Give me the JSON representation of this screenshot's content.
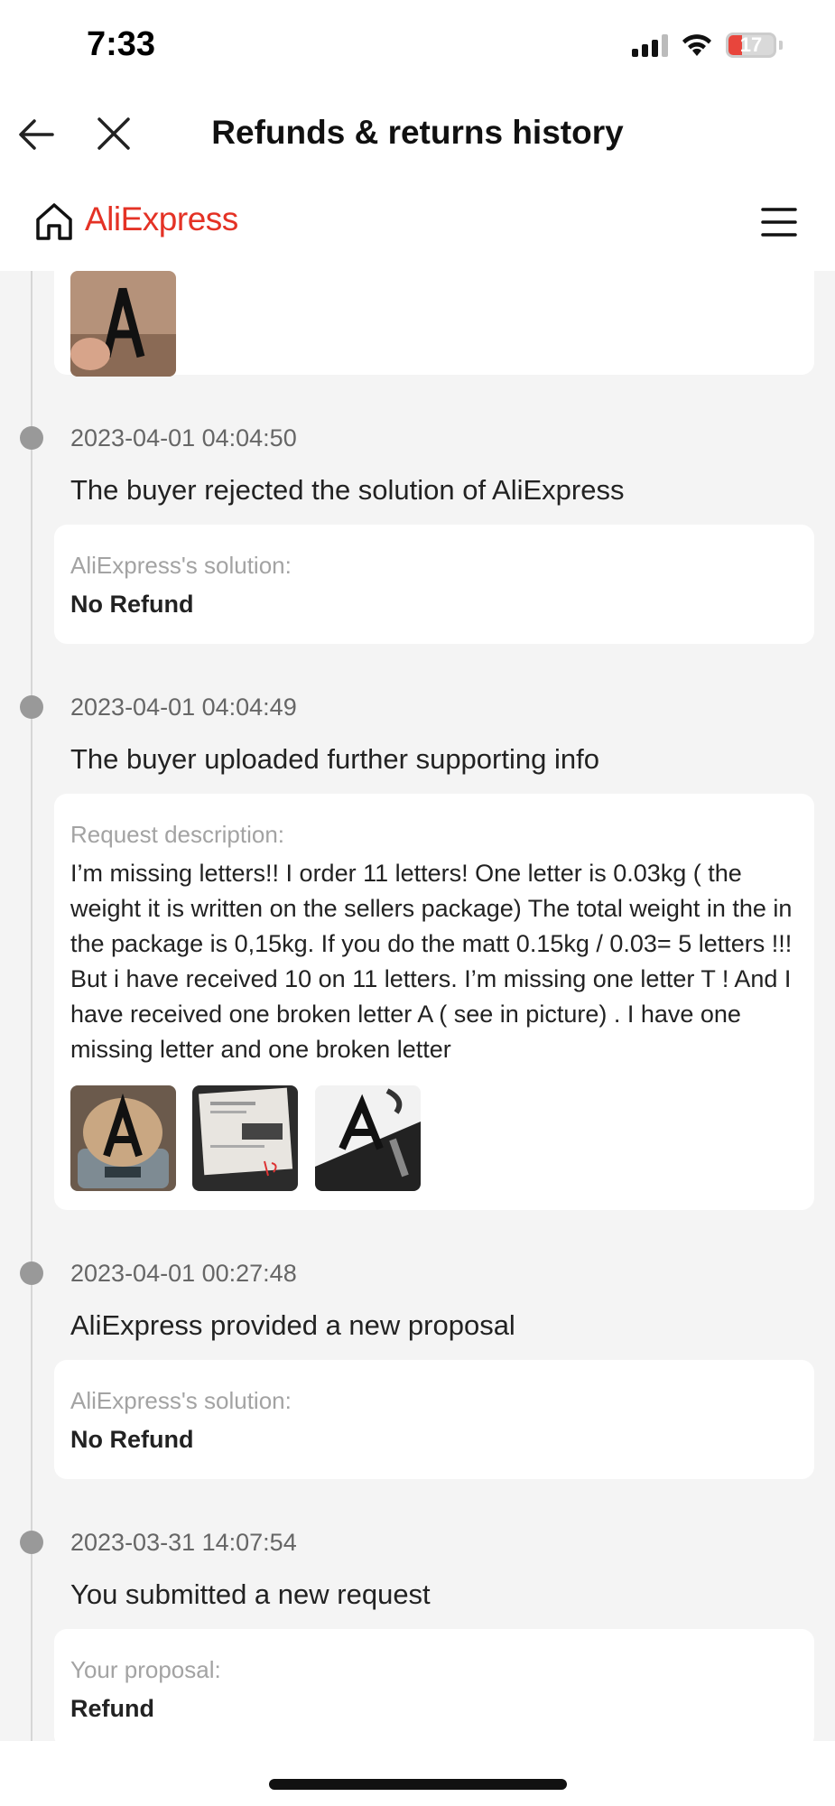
{
  "status_bar": {
    "time": "7:33",
    "battery": "17"
  },
  "nav": {
    "title": "Refunds & returns history"
  },
  "app": {
    "logo": "AliExpress"
  },
  "events": [
    {
      "timestamp": "2023-04-01 04:04:50",
      "title": "The buyer rejected the solution of AliExpress",
      "label": "AliExpress's solution:",
      "value": "No Refund"
    },
    {
      "timestamp": "2023-04-01 04:04:49",
      "title": "The buyer uploaded further supporting info",
      "label": "Request description:",
      "description": "I’m missing letters!! I order 11 letters! One letter is 0.03kg ( the weight it is written on the sellers package) The total weight in the in the package is 0,15kg. If you do the matt 0.15kg / 0.03= 5 letters !!! But i have received 10 on 11 letters. I’m missing one letter T ! And I have received one broken letter A ( see in picture) . I have one missing letter and one broken letter"
    },
    {
      "timestamp": "2023-04-01 00:27:48",
      "title": "AliExpress provided a new proposal",
      "label": "AliExpress's solution:",
      "value": "No Refund"
    },
    {
      "timestamp": "2023-03-31 14:07:54",
      "title": "You submitted a new request",
      "label": "Your proposal:",
      "value": "Refund"
    }
  ]
}
